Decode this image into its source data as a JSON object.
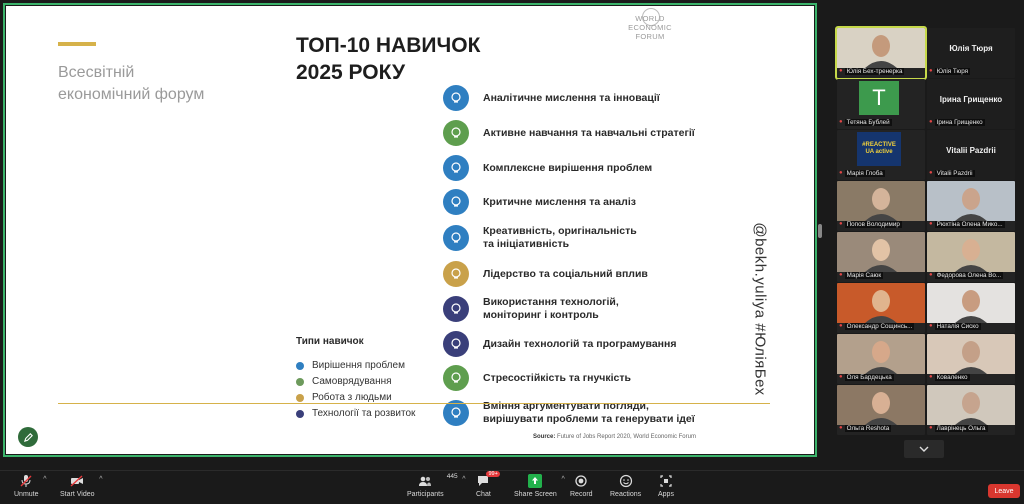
{
  "slide": {
    "left_title": "Всесвітній\nекономічний форум",
    "logo_text": "WORLD\nECONOMIC\nFORUM",
    "main_title": "ТОП-10 НАВИЧОК\n2025 РОКУ",
    "watermark": "@bekh.yuliya #ЮліяБех",
    "skills": [
      {
        "label": "Аналітичне мислення та інновації",
        "color": "#2f7fc1",
        "icon": "head-gears-icon"
      },
      {
        "label": "Активне навчання та навчальні стратегії",
        "color": "#5e9e4e",
        "icon": "brain-icon"
      },
      {
        "label": "Комплексне вирішення проблем",
        "color": "#2f7fc1",
        "icon": "puzzle-icon"
      },
      {
        "label": "Критичне мислення та аналіз",
        "color": "#2f7fc1",
        "icon": "head-icon"
      },
      {
        "label": "Креативність, оригінальність\nта ініціативність",
        "color": "#2f7fc1",
        "icon": "lightbulb-head-icon"
      },
      {
        "label": "Лідерство та соціальний вплив",
        "color": "#c9a14a",
        "icon": "leader-icon"
      },
      {
        "label": "Використання технологій,\nмоніторинг і контроль",
        "color": "#3a3f7a",
        "icon": "chip-icon"
      },
      {
        "label": "Дизайн технологій та програмування",
        "color": "#3a3f7a",
        "icon": "code-icon"
      },
      {
        "label": "Стресостійкість та гнучкість",
        "color": "#5e9e4e",
        "icon": "flex-icon"
      },
      {
        "label": "Вміння аргументувати погляди,\nвирішувати проблеми та генерувати ідеї",
        "color": "#2f7fc1",
        "icon": "question-icon"
      }
    ],
    "types_title": "Типи навичок",
    "types": [
      {
        "label": "Вирішення проблем",
        "color": "#2f7fc1"
      },
      {
        "label": "Самоврядування",
        "color": "#6d9a5c"
      },
      {
        "label": "Робота з людьми",
        "color": "#c9a14a"
      },
      {
        "label": "Технології та розвиток",
        "color": "#3a3f7a"
      }
    ],
    "source_label": "Source:",
    "source_text": "Future of Jobs Report 2020, World Economic Forum"
  },
  "gallery": [
    {
      "name": "Юлія Бех-тренерка",
      "kind": "photo",
      "active": true,
      "bg": "#d9d2c4",
      "face": "#c49a7c"
    },
    {
      "name": "Юлія Тюря",
      "kind": "name",
      "big": "Юлія Тюря"
    },
    {
      "name": "Тетяна Бублей",
      "kind": "avatar",
      "letter": "T"
    },
    {
      "name": "Ірина Грищенко",
      "kind": "name",
      "big": "Ірина Грищенко"
    },
    {
      "name": "Марія Глоба",
      "kind": "banner",
      "banner": "#REACTIVE\nUA active"
    },
    {
      "name": "Vitalii Pazdrii",
      "kind": "name",
      "big": "Vitalii Pazdrii"
    },
    {
      "name": "Попов Володимир",
      "kind": "photo",
      "bg": "#8a7a66",
      "face": "#d4b49a"
    },
    {
      "name": "Рюхтіна Олена Мико...",
      "kind": "photo",
      "bg": "#b8c0c8",
      "face": "#caa48c"
    },
    {
      "name": "Марія Саюк",
      "kind": "photo",
      "bg": "#9a8a7a",
      "face": "#e2c3a6"
    },
    {
      "name": "Федорова Олена Во...",
      "kind": "photo",
      "bg": "#c4b8a0",
      "face": "#d8b092"
    },
    {
      "name": "Олександр Сощинсь...",
      "kind": "photo",
      "bg": "#c85a2a",
      "face": "#e0b48e"
    },
    {
      "name": "Наталія Сиско",
      "kind": "photo",
      "bg": "#e4e2e0",
      "face": "#c89c80"
    },
    {
      "name": "Оля Бардецька",
      "kind": "photo",
      "bg": "#b3a08c",
      "face": "#d6a88a"
    },
    {
      "name": "Коваленко",
      "kind": "photo",
      "bg": "#d8c8b8",
      "face": "#c4a088"
    },
    {
      "name": "Ольга Reshota",
      "kind": "photo",
      "bg": "#8c7864",
      "face": "#d8b094"
    },
    {
      "name": "Лаврінець Ольга",
      "kind": "photo",
      "bg": "#d0c8bc",
      "face": "#c6a48e"
    }
  ],
  "toolbar": {
    "unmute": "Unmute",
    "start_video": "Start Video",
    "participants": "Participants",
    "participants_count": "445",
    "chat": "Chat",
    "chat_badge": "99+",
    "share": "Share Screen",
    "record": "Record",
    "reactions": "Reactions",
    "apps": "Apps",
    "leave": "Leave"
  },
  "colors": {
    "share_border": "#3bb36b",
    "gold": "#d6b24a",
    "leave": "#d9372f",
    "share_button": "#22b14c"
  }
}
